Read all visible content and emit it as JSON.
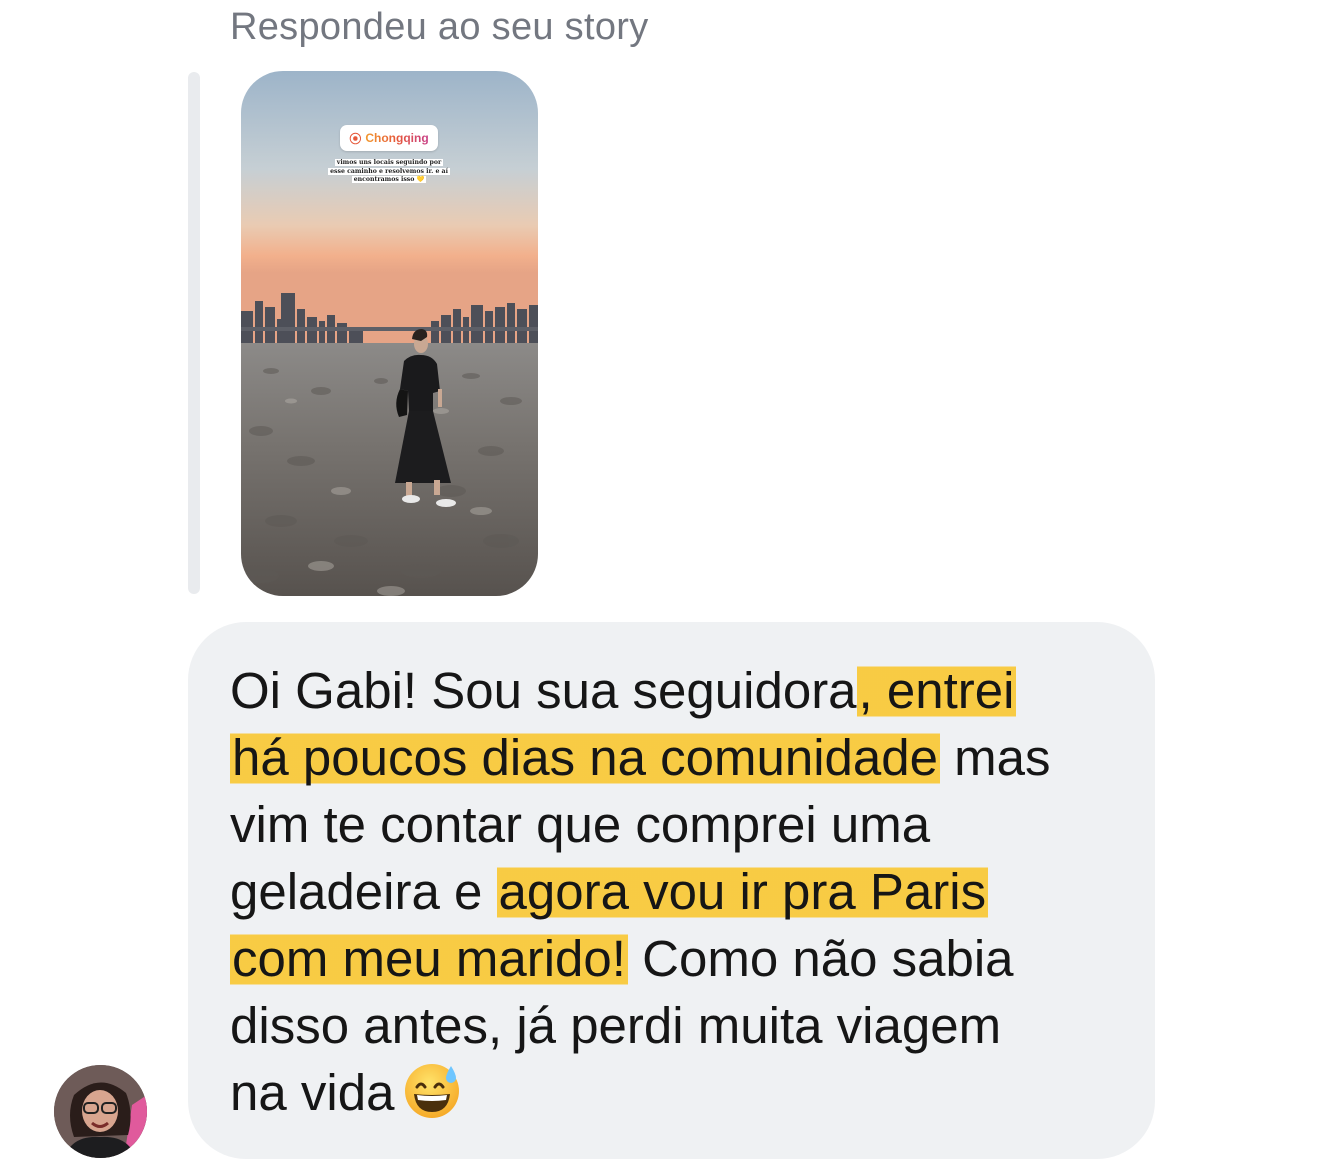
{
  "header": {
    "reply_label": "Respondeu ao seu story"
  },
  "story": {
    "location_sticker": "Chongqing",
    "caption_lines": [
      "vimos uns locais seguindo por",
      "esse caminho e resolvemos ir. e aí",
      "encontramos isso 💛"
    ]
  },
  "message": {
    "lines": [
      [
        {
          "text": "Oi Gabi! Sou sua seguidora",
          "highlight": false
        },
        {
          "text": ", entrei",
          "highlight": true
        }
      ],
      [
        {
          "text": "há poucos dias na comunidade",
          "highlight": true
        },
        {
          "text": " mas",
          "highlight": false
        }
      ],
      [
        {
          "text": "vim te contar que comprei uma",
          "highlight": false
        }
      ],
      [
        {
          "text": "geladeira e ",
          "highlight": false
        },
        {
          "text": "agora vou ir pra Paris",
          "highlight": true
        }
      ],
      [
        {
          "text": "com meu marido!",
          "highlight": true
        },
        {
          "text": " Como não sabia",
          "highlight": false
        }
      ],
      [
        {
          "text": "disso antes, já perdi muita viagem",
          "highlight": false
        }
      ],
      [
        {
          "text": "na vida",
          "highlight": false
        }
      ]
    ],
    "trailing_emoji": "grinning-face-with-sweat-emoji",
    "highlight_color": "#fac31e",
    "bubble_color": "#eff1f3"
  },
  "sender": {
    "avatar": "profile-photo"
  }
}
